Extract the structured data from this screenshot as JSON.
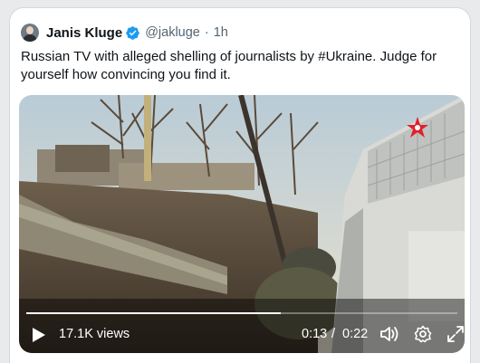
{
  "tweet": {
    "author_name": "Janis Kluge",
    "handle": "@jakluge",
    "separator": "·",
    "time": "1h",
    "text_before": "Russian TV with alleged shelling of journalists by ",
    "hashtag": "#Ukraine",
    "text_after": ". Judge for yourself how convincing you find it."
  },
  "video": {
    "views": "17.1K views",
    "current_time": "0:13",
    "time_sep": "/",
    "duration": "0:22",
    "progress": 0.59
  },
  "colors": {
    "verified": "#1d9bf0",
    "watermark_star": "#e0202a"
  }
}
